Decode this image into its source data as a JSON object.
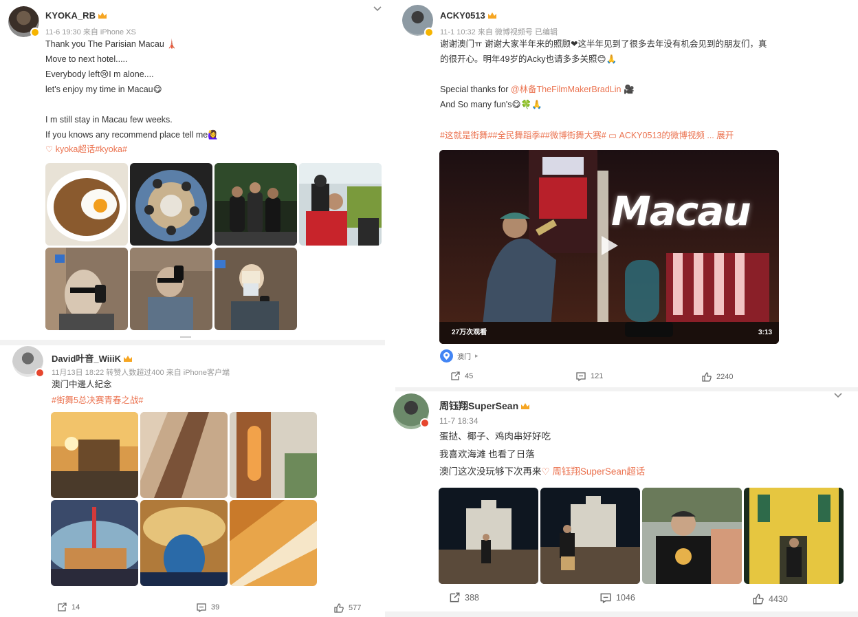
{
  "colors": {
    "accent": "#eb7350",
    "badge_gold": "#f6b400",
    "badge_red": "#e6462e",
    "action": "#666666"
  },
  "posts": [
    {
      "user": "KYOKA_RB",
      "meta": "11-6 19:30 来自 iPhone XS",
      "lines": [
        "Thank you The Parisian Macau 🗼",
        "Move to next hotel.....",
        "Everybody left😢I m alone....",
        "let's enjoy my time in Macau😋",
        "",
        "I m still stay in Macau few weeks.",
        "If you knows any recommend place tell me🙋‍♀️"
      ],
      "topic": "kyoka超话#kyoka#",
      "photos": [
        "fried-egg-ramen",
        "group-fisheye",
        "group-night-street",
        "group-convenience-store",
        "elevator-selfie-1",
        "elevator-selfie-2",
        "elevator-selfie-3"
      ]
    },
    {
      "user": "ACKY0513",
      "meta": "11-1 10:32 来自 微博视频号 已编辑",
      "lines": [
        "谢谢澳门ㅠ 谢谢大家半年来的照顾❤这半年见到了很多去年没有机会见到的朋友们，真",
        "的很开心。明年49岁的Acky也请多多关照😊🙏",
        "",
        "Special thanks for @林备TheFilmMakerBradLin 🎥",
        "And So many fun's😋🍀🙏"
      ],
      "topics": "#这就是街舞##全民舞蹈季##微博街舞大赛#",
      "video_link": "ACKY0513的微博视频",
      "more": "... 展开",
      "video": {
        "title": "Macau",
        "views": "27万次观看",
        "duration": "3:13"
      },
      "location": "澳门",
      "actions": {
        "repost": "45",
        "comment": "121",
        "like": "2240"
      }
    },
    {
      "user": "David叶音_WiiiK",
      "meta": "11月13日 18:22 转赞人数超过400  来自 iPhone客户端",
      "lines": [
        "澳门中邊人紀念"
      ],
      "topic": "#街舞5总决赛青春之战#",
      "photos": [
        "sunset-city",
        "escalator-mirror",
        "lit-tower",
        "fisheye-tower",
        "fountain-hall",
        "ceiling-detail"
      ],
      "actions": {
        "repost": "14",
        "comment": "39",
        "like": "577"
      }
    },
    {
      "user": "周钰翔SuperSean",
      "meta": "11-7 18:34",
      "lines": [
        "蛋挞、椰子、鸡肉串好好吃",
        "我喜欢海滩 也看了日落"
      ],
      "last_line": "澳门这次没玩够下次再来",
      "topic": "周钰翔SuperSean超话",
      "photos": [
        "ruins-st-paul",
        "ruins-jump",
        "street-portrait",
        "yellow-church"
      ],
      "actions": {
        "repost": "388",
        "comment": "1046",
        "like": "4430"
      }
    }
  ]
}
